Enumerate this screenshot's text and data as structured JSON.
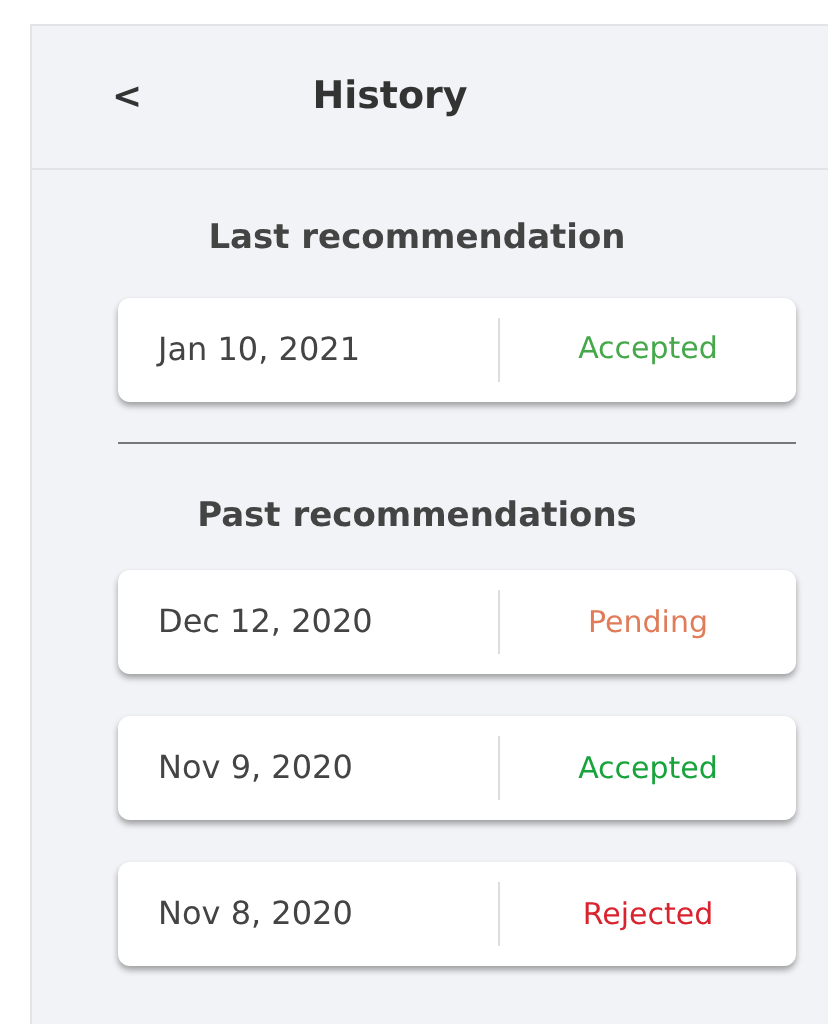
{
  "header": {
    "back": "<",
    "title": "History"
  },
  "last": {
    "heading": "Last recommendation",
    "items": [
      {
        "date": "Jan 10, 2021",
        "status": "Accepted",
        "color": "#45a84a"
      }
    ]
  },
  "past": {
    "heading": "Past recommendations",
    "items": [
      {
        "date": "Dec 12, 2020",
        "status": "Pending",
        "color": "#e07c5a"
      },
      {
        "date": "Nov 9, 2020",
        "status": "Accepted",
        "color": "#18a43c"
      },
      {
        "date": "Nov 8, 2020",
        "status": "Rejected",
        "color": "#d9232e"
      }
    ]
  }
}
